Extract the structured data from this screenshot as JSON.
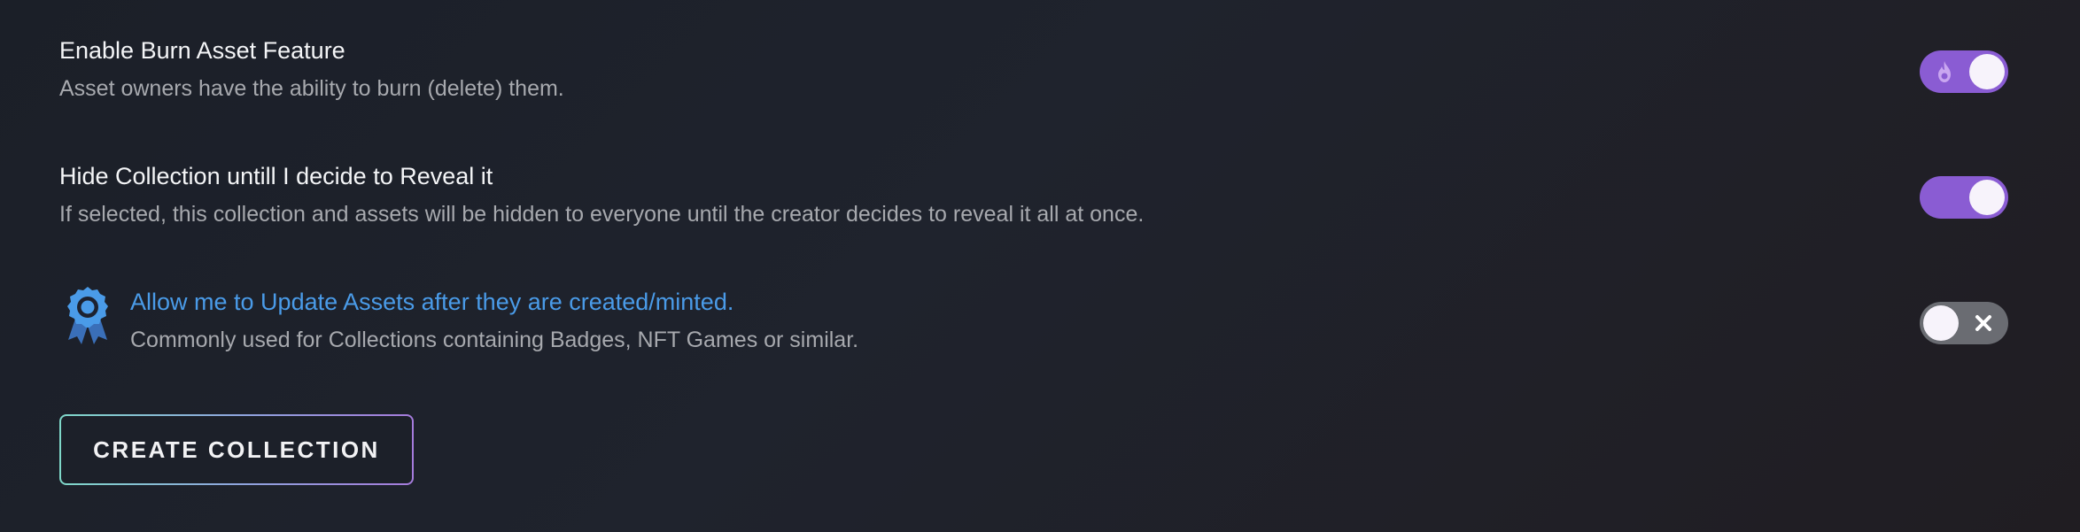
{
  "settings": {
    "burn": {
      "title": "Enable Burn Asset Feature",
      "description": "Asset owners have the ability to burn (delete) them.",
      "enabled": true,
      "icon": "flame-icon"
    },
    "hide": {
      "title": "Hide Collection untill I decide to Reveal it",
      "description": "If selected, this collection and assets will be hidden to everyone until the creator decides to reveal it all at once.",
      "enabled": true
    },
    "update": {
      "title": "Allow me to Update Assets after they are created/minted.",
      "description": "Commonly used for Collections containing Badges, NFT Games or similar.",
      "enabled": false,
      "icon": "award-badge-icon"
    }
  },
  "actions": {
    "create_label": "CREATE COLLECTION"
  },
  "colors": {
    "toggle_on": "#8a5cd3",
    "toggle_off": "#6a6c72",
    "link_blue": "#4a9be8",
    "button_border_start": "#7fd8c9",
    "button_border_end": "#a57bdc"
  }
}
